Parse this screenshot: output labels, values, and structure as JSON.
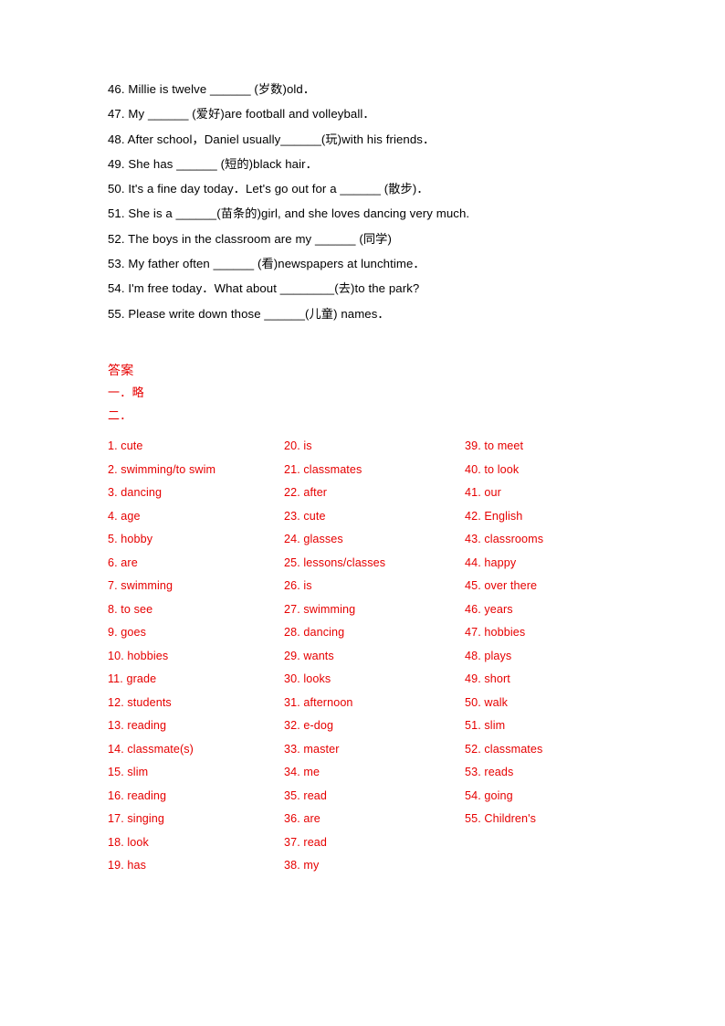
{
  "document": {
    "questions": [
      "46. Millie is twelve ______ (岁数)old．",
      "47. My ______ (爱好)are football and volleyball．",
      "48. After school，Daniel usually______(玩)with his friends．",
      "49. She has ______ (短的)black hair．",
      "50. It's a fine day today．Let's go out for a ______ (散步)．",
      "51. She is a ______(苗条的)girl, and she loves dancing very much.",
      "52. The boys in the classroom are my ______ (同学)",
      "53. My father often ______ (看)newspapers at lunchtime．",
      "54. I'm free today．What about ________(去)to the park?",
      "55. Please write down those ______(儿童) names．"
    ],
    "answer_section": {
      "title": "答案",
      "part_one": "一．略",
      "part_two": "二．",
      "columns": [
        [
          "1. cute",
          "2. swimming/to swim",
          "3. dancing",
          "4. age",
          "5. hobby",
          "6. are",
          "7. swimming",
          "8. to see",
          "9. goes",
          "10. hobbies",
          "11. grade",
          "12. students",
          "13. reading",
          "14. classmate(s)",
          "15. slim",
          "16. reading",
          "17. singing",
          "18. look",
          "19. has"
        ],
        [
          "20. is",
          "21. classmates",
          "22. after",
          "23. cute",
          "24. glasses",
          "25. lessons/classes",
          "26. is",
          "27. swimming",
          "28. dancing",
          "29. wants",
          "30. looks",
          "31. afternoon",
          "32. e-dog",
          "33. master",
          "34. me",
          "35. read",
          "36. are",
          "37. read",
          "38. my"
        ],
        [
          "39. to meet",
          "40. to look",
          "41. our",
          "42. English",
          "43. classrooms",
          "44. happy",
          "45. over there",
          "46. years",
          "47. hobbies",
          "48. plays",
          "49. short",
          "50. walk",
          "51. slim",
          "52. classmates",
          "53. reads",
          "54. going",
          "55. Children's"
        ]
      ]
    },
    "colors": {
      "answer_red": "#e60000",
      "question_black": "#000000",
      "page_background": "#ffffff"
    }
  }
}
